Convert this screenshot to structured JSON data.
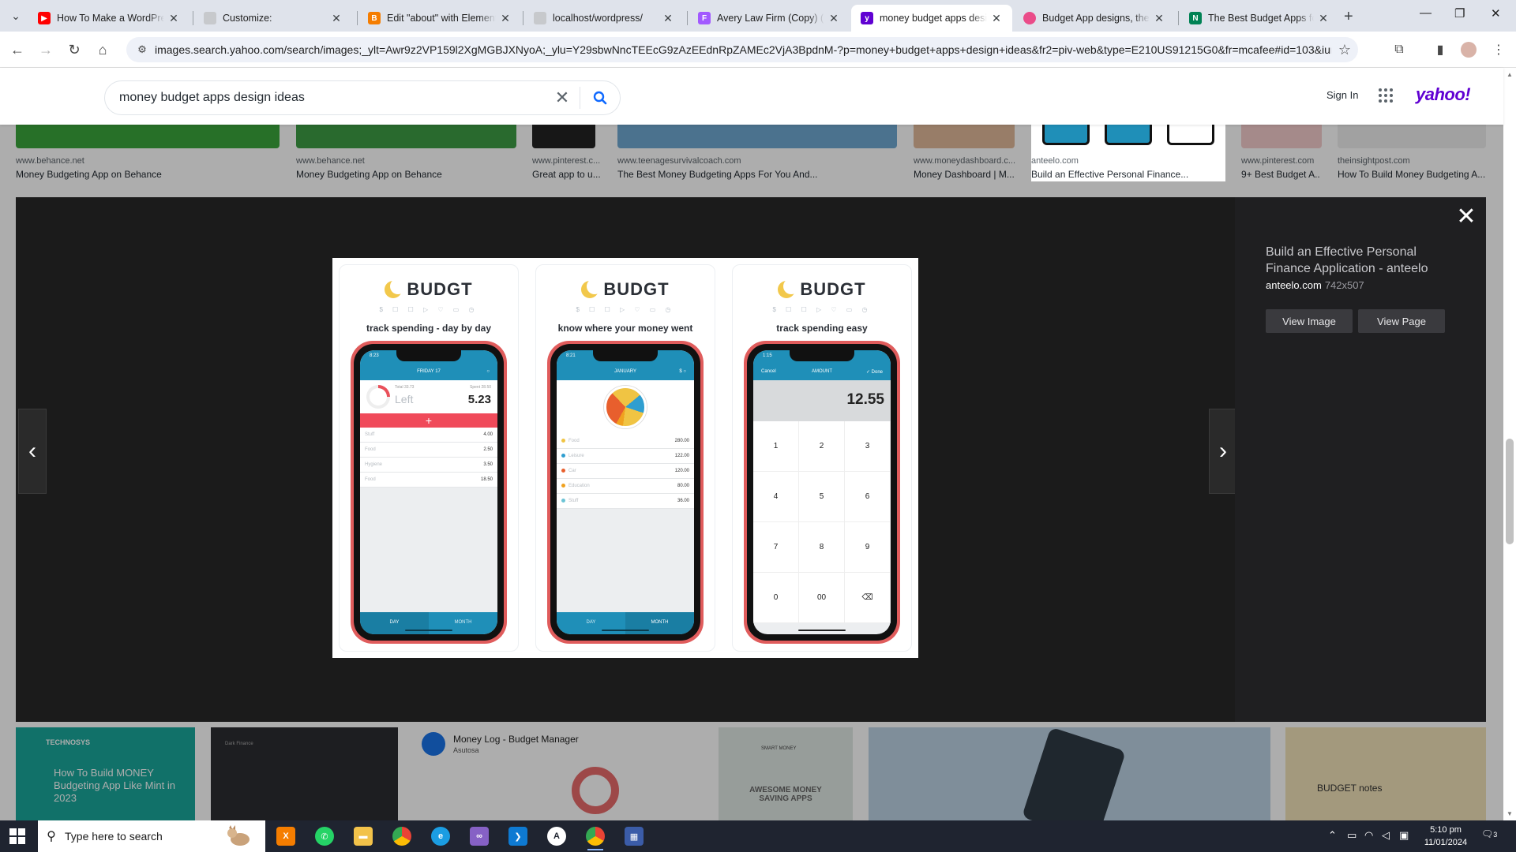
{
  "browser": {
    "tabs": [
      {
        "label": "How To Make a WordPress",
        "favicon": "youtube-icon",
        "color": "#ff0000"
      },
      {
        "label": "Customize:",
        "favicon": "page-icon",
        "color": "#9aa0a6"
      },
      {
        "label": "Edit \"about\" with Elementor",
        "favicon": "blogger-icon",
        "color": "#f57d00"
      },
      {
        "label": "localhost/wordpress/",
        "favicon": "page-icon",
        "color": "#9aa0a6"
      },
      {
        "label": "Avery Law Firm (Copy) (C",
        "favicon": "figma-icon",
        "color": "#a259ff"
      },
      {
        "label": "money budget apps desig",
        "favicon": "yahoo-icon",
        "color": "#6001d2"
      },
      {
        "label": "Budget App designs, then",
        "favicon": "dribbble-icon",
        "color": "#ea4c89"
      },
      {
        "label": "The Best Budget Apps for",
        "favicon": "nerdwallet-icon",
        "color": "#008254"
      }
    ],
    "url": "images.search.yahoo.com/search/images;_ylt=Awr9z2VP159l2XgMGBJXNyoA;_ylu=Y29sbwNncTEEcG9zAzEEdnRpZAMEc2VjA3BpdnM-?p=money+budget+apps+design+ideas&fr2=piv-web&type=E210US91215G0&fr=mcafee#id=103&iurl=htt..."
  },
  "yahoo": {
    "query": "money budget apps design ideas",
    "sign_in": "Sign In",
    "logo": "yahoo!",
    "brand_color": "#6001d2"
  },
  "top_results": [
    {
      "source": "www.behance.net",
      "title": "Money Budgeting App on Behance"
    },
    {
      "source": "www.behance.net",
      "title": "Money Budgeting App on Behance"
    },
    {
      "source": "www.pinterest.c...",
      "title": "Great app to u..."
    },
    {
      "source": "www.teenagesurvivalcoach.com",
      "title": "The Best Money Budgeting Apps For You And..."
    },
    {
      "source": "www.moneydashboard.c...",
      "title": "Money Dashboard | M..."
    },
    {
      "source": "anteelo.com",
      "title": "Build an Effective Personal Finance..."
    },
    {
      "source": "www.pinterest.com",
      "title": "9+ Best Budget A..."
    },
    {
      "source": "theinsightpost.com",
      "title": "How To Build Money Budgeting A..."
    }
  ],
  "lightbox": {
    "title": "Build an Effective Personal Finance Application - anteelo",
    "domain": "anteelo.com",
    "dimensions": "742x507",
    "view_image": "View Image",
    "view_page": "View Page",
    "image": {
      "brand": "BUDGT",
      "dots": "$ ☐ ☐ ▷ ♡ ▭ ◷",
      "screens": [
        {
          "tagline": "track spending - day by day",
          "time": "8:23",
          "header": "FRIDAY 17",
          "total": "Total 33.73",
          "spent": "Spent 28.50",
          "left_label": "Left",
          "left_amount": "5.23",
          "plus": "+",
          "rows": [
            {
              "label": "Stuff",
              "value": "4.00"
            },
            {
              "label": "Food",
              "value": "2.50"
            },
            {
              "label": "Hygiene",
              "value": "3.50"
            },
            {
              "label": "Food",
              "value": "18.50"
            }
          ],
          "tabs": [
            "DAY",
            "MONTH"
          ]
        },
        {
          "tagline": "know where your money went",
          "time": "8:21",
          "header": "JANUARY",
          "rows": [
            {
              "label": "Food",
              "value": "280.00",
              "color": "#f0c443"
            },
            {
              "label": "Leisure",
              "value": "122.00",
              "color": "#2f9ed0"
            },
            {
              "label": "Car",
              "value": "120.00",
              "color": "#e85f2d"
            },
            {
              "label": "Education",
              "value": "80.00",
              "color": "#f0a11f"
            },
            {
              "label": "Stuff",
              "value": "36.00",
              "color": "#6cc3d5"
            }
          ],
          "tabs": [
            "DAY",
            "MONTH"
          ]
        },
        {
          "tagline": "track spending easy",
          "time": "1:15",
          "cancel": "Cancel",
          "header": "AMOUNT",
          "done": "✓ Done",
          "amount": "12.55",
          "keys": [
            "1",
            "2",
            "3",
            "4",
            "5",
            "6",
            "7",
            "8",
            "9",
            "0",
            "00",
            "⌫"
          ]
        }
      ]
    }
  },
  "bottom_results": [
    {
      "label": "TECHNOSYS",
      "caption": "How To Build MONEY Budgeting App Like Mint in 2023"
    },
    {
      "label": "Dark Finance"
    },
    {
      "label": "Money Log - Budget Manager",
      "sub": "Asutosa"
    },
    {
      "label": "SMART MONEY",
      "caption": "AWESOME MONEY SAVING APPS"
    },
    {
      "label": "phone-budget-photo"
    },
    {
      "label": "BUDGET notes"
    }
  ],
  "taskbar": {
    "search_placeholder": "Type here to search",
    "time": "5:10 pm",
    "date": "11/01/2024",
    "notifications": "3"
  }
}
